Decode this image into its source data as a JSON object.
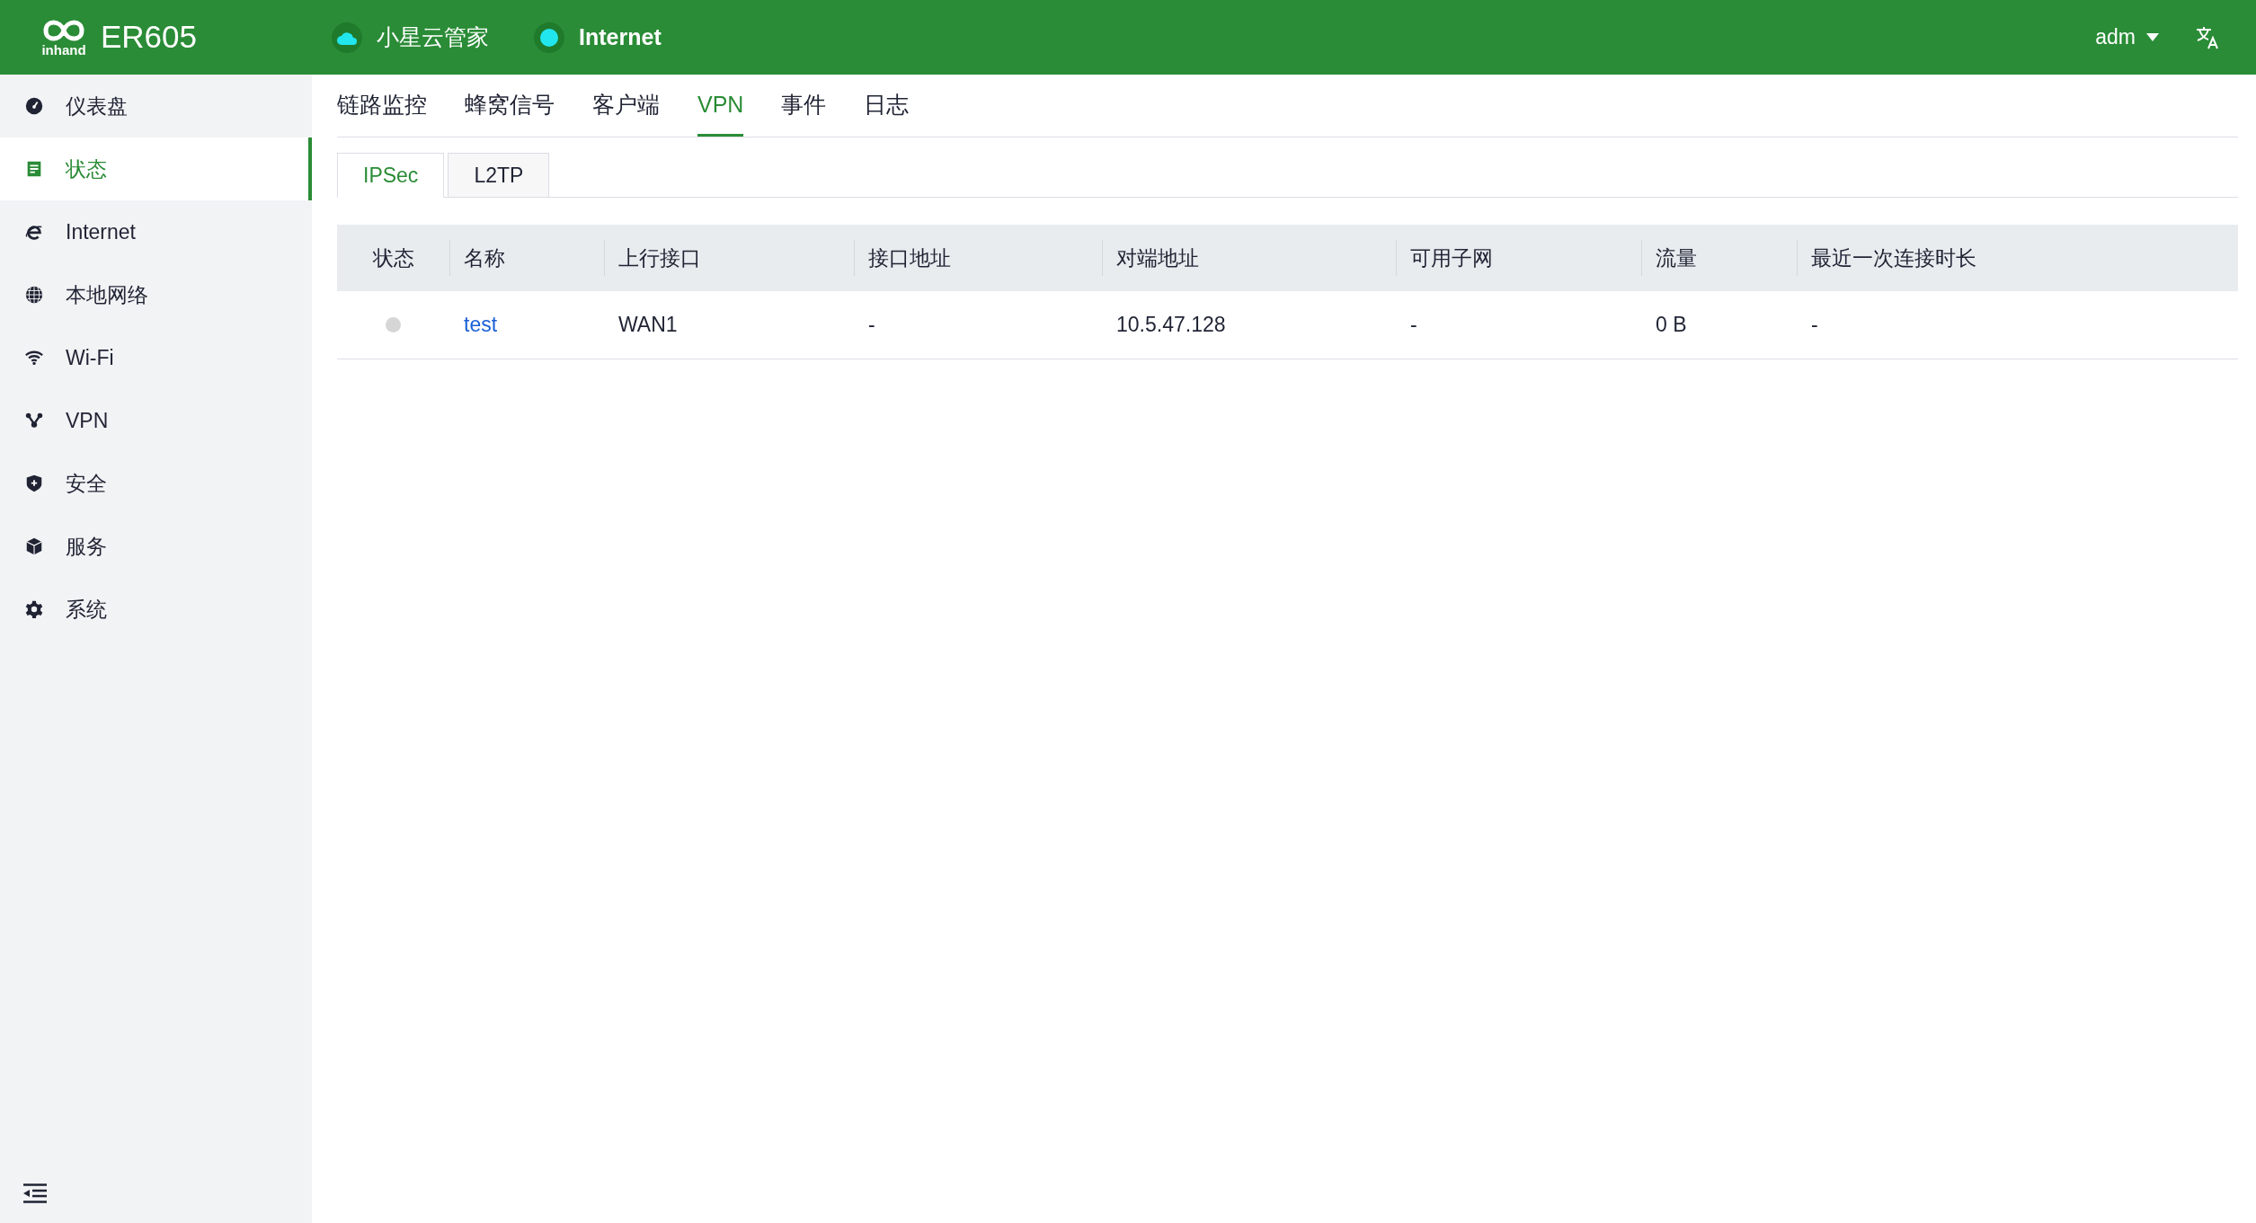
{
  "header": {
    "logo_text": "inhand",
    "product": "ER605",
    "cloud": {
      "label": "小星云管家",
      "connected": true
    },
    "internet": {
      "label": "Internet",
      "connected": true
    },
    "user": "adm"
  },
  "sidebar": {
    "items": [
      {
        "label": "仪表盘",
        "selected": false
      },
      {
        "label": "状态",
        "selected": true
      },
      {
        "label": "Internet",
        "selected": false
      },
      {
        "label": "本地网络",
        "selected": false
      },
      {
        "label": "Wi-Fi",
        "selected": false
      },
      {
        "label": "VPN",
        "selected": false
      },
      {
        "label": "安全",
        "selected": false
      },
      {
        "label": "服务",
        "selected": false
      },
      {
        "label": "系统",
        "selected": false
      }
    ]
  },
  "tabs": [
    {
      "label": "链路监控",
      "selected": false
    },
    {
      "label": "蜂窝信号",
      "selected": false
    },
    {
      "label": "客户端",
      "selected": false
    },
    {
      "label": "VPN",
      "selected": true
    },
    {
      "label": "事件",
      "selected": false
    },
    {
      "label": "日志",
      "selected": false
    }
  ],
  "subtabs": [
    {
      "label": "IPSec",
      "selected": true
    },
    {
      "label": "L2TP",
      "selected": false
    }
  ],
  "table": {
    "columns": [
      "状态",
      "名称",
      "上行接口",
      "接口地址",
      "对端地址",
      "可用子网",
      "流量",
      "最近一次连接时长"
    ],
    "rows": [
      {
        "connected": false,
        "name": "test",
        "uplink": "WAN1",
        "interface_address": "-",
        "peer_address": "10.5.47.128",
        "subnets": "-",
        "traffic": "0 B",
        "last_duration": "-"
      }
    ]
  }
}
